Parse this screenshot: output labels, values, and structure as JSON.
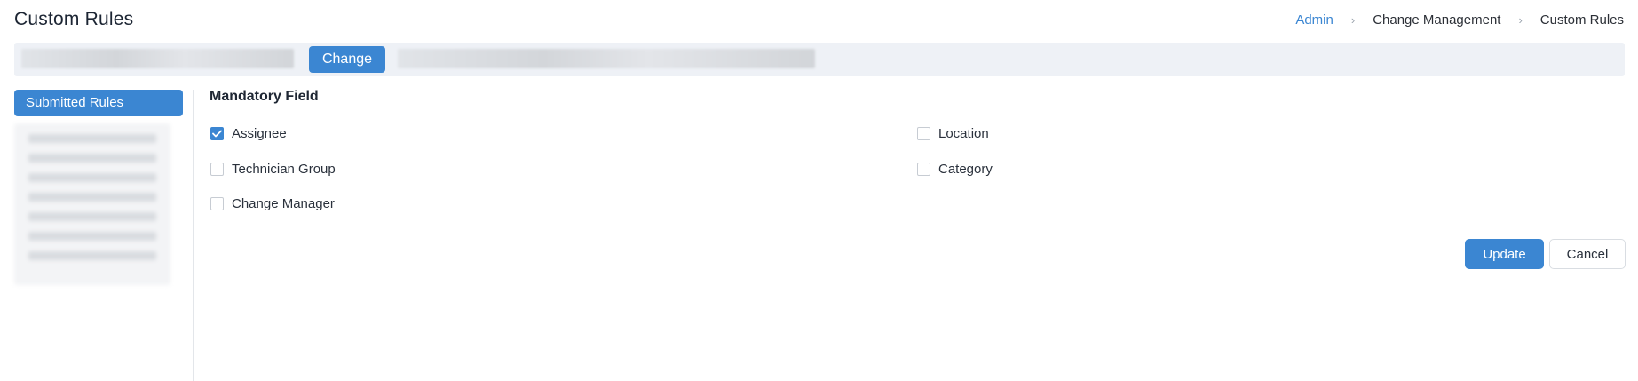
{
  "header": {
    "title": "Custom Rules"
  },
  "breadcrumb": [
    {
      "label": "Admin",
      "link": true
    },
    {
      "label": "Change Management",
      "link": false
    },
    {
      "label": "Custom Rules",
      "link": false
    }
  ],
  "breadcrumb_separator": "›",
  "module_bar": {
    "button_label": "Change"
  },
  "sidebar": {
    "items": [
      {
        "label": "Submitted Rules",
        "active": true
      }
    ]
  },
  "section": {
    "title": "Mandatory Field",
    "fields": [
      {
        "label": "Assignee",
        "checked": true
      },
      {
        "label": "Location",
        "checked": false
      },
      {
        "label": "Technician Group",
        "checked": false
      },
      {
        "label": "Category",
        "checked": false
      },
      {
        "label": "Change Manager",
        "checked": false
      }
    ]
  },
  "actions": {
    "update_label": "Update",
    "cancel_label": "Cancel"
  },
  "colors": {
    "accent": "#3b86d2",
    "panel_bg": "#eef1f6"
  },
  "icons": {
    "checkmark": "check-icon",
    "separator": "chevron-right-icon"
  }
}
